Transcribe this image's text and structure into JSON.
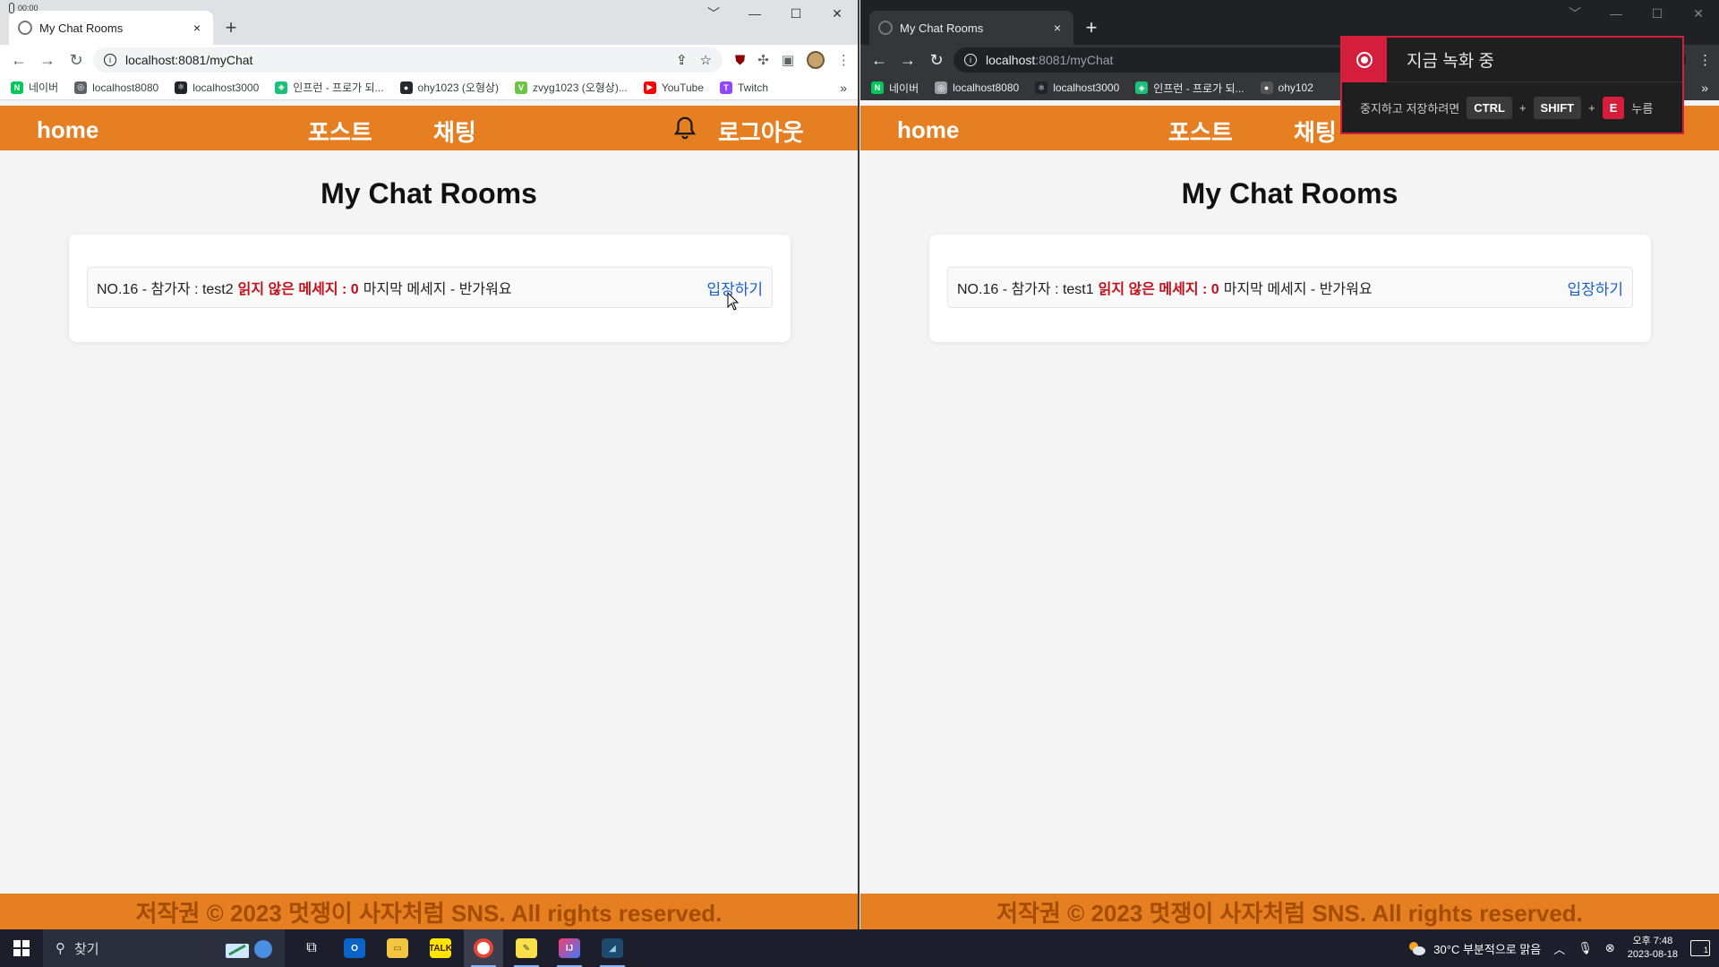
{
  "recording_timer": "00:00",
  "browser": {
    "tab_title": "My Chat Rooms",
    "tab_close": "×",
    "new_tab": "+",
    "url_host": "localhost",
    "url_rest": ":8081/myChat",
    "window_controls": [
      "﹀",
      "—",
      "☐",
      "✕"
    ],
    "nav": {
      "back": "←",
      "forward": "→",
      "reload": "↻"
    },
    "bookmarks_left": [
      {
        "label": "네이버",
        "icon": "N",
        "color": "#03c75a"
      },
      {
        "label": "localhost8080",
        "icon": "◎",
        "color": "#5f6368"
      },
      {
        "label": "localhost3000",
        "icon": "⚛",
        "color": "#20232a"
      },
      {
        "label": "인프런 - 프로가 되...",
        "icon": "◈",
        "color": "#1dc078"
      },
      {
        "label": "ohy1023 (오형상)",
        "icon": "●",
        "color": "#24292f"
      },
      {
        "label": "zvyg1023 (오형상)...",
        "icon": "V",
        "color": "#6cc644"
      },
      {
        "label": "YouTube",
        "icon": "▶",
        "color": "#ff0000"
      },
      {
        "label": "Twitch",
        "icon": "T",
        "color": "#9146ff"
      }
    ],
    "bookmarks_right": [
      {
        "label": "네이버",
        "icon": "N",
        "color": "#03c75a"
      },
      {
        "label": "localhost8080",
        "icon": "◎",
        "color": "#9aa0a6"
      },
      {
        "label": "localhost3000",
        "icon": "⚛",
        "color": "#20232a"
      },
      {
        "label": "인프런 - 프로가 되...",
        "icon": "◈",
        "color": "#1dc078"
      },
      {
        "label": "ohy102",
        "icon": "●",
        "color": "#555"
      }
    ],
    "bookmarks_more": "»"
  },
  "site": {
    "nav_home": "home",
    "nav_post": "포스트",
    "nav_chat": "채팅",
    "nav_logout": "로그아웃",
    "page_title": "My Chat Rooms",
    "footer": "저작권 © 2023 멋쟁이 사자처럼 SNS. All rights reserved.",
    "accent_color": "#e67e22"
  },
  "left_room": {
    "prefix": "NO.16 - 참가자 : test2",
    "unread": "읽지 않은 메세지 : 0",
    "last": "마지막 메세지 - 반가워요",
    "enter": "입장하기"
  },
  "right_room": {
    "prefix": "NO.16 - 참가자 : test1",
    "unread": "읽지 않은 메세지 : 0",
    "last": "마지막 메세지 - 반가워요",
    "enter": "입장하기"
  },
  "recording": {
    "label": "지금 녹화 중",
    "hint_prefix": "중지하고 저장하려면",
    "key_ctrl": "CTRL",
    "key_shift": "SHIFT",
    "key_e": "E",
    "plus": "+",
    "hint_suffix": "누름"
  },
  "taskbar": {
    "search_label": "찾기",
    "weather": "30°C  부분적으로 맑음",
    "time": "오후 7:48",
    "date": "2023-08-18",
    "notifications": "1"
  }
}
